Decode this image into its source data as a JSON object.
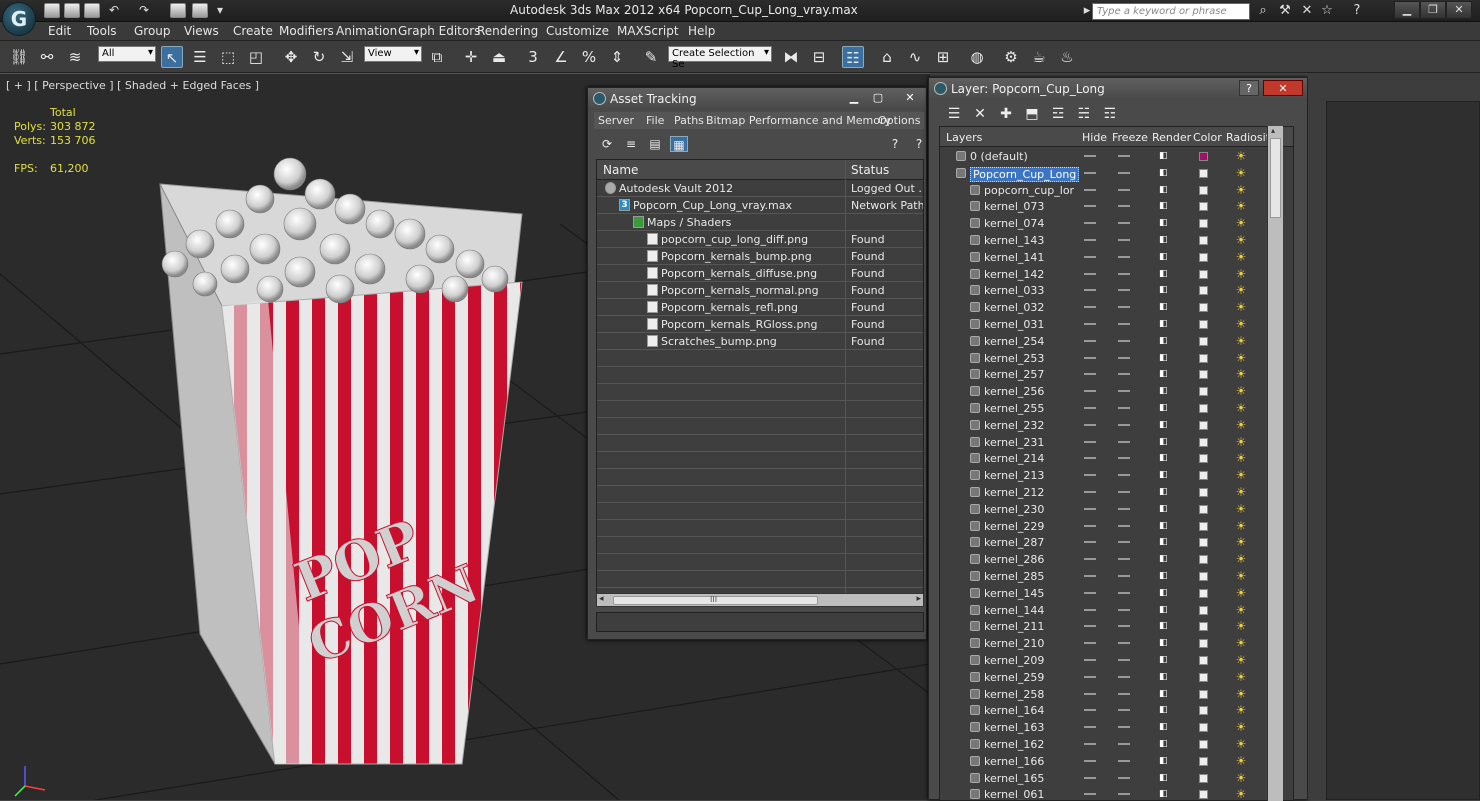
{
  "app": {
    "title": "Autodesk 3ds Max  2012 x64      Popcorn_Cup_Long_vray.max",
    "search_placeholder": "Type a keyword or phrase",
    "logo": "G"
  },
  "menu": [
    "Edit",
    "Tools",
    "Group",
    "Views",
    "Create",
    "Modifiers",
    "Animation",
    "Graph Editors",
    "Rendering",
    "Customize",
    "MAXScript",
    "Help"
  ],
  "toolbar": {
    "selection_filter": "All",
    "reference_coord": "View",
    "named_selection": "Create Selection Se"
  },
  "viewport": {
    "label": "[ + ] [ Perspective ] [ Shaded + Edged Faces ]",
    "stats_header": "Total",
    "polys_label": "Polys:",
    "polys_value": "303 872",
    "verts_label": "Verts:",
    "verts_value": "153 706",
    "fps_label": "FPS:",
    "fps_value": "61,200",
    "logo_text_1": "POP",
    "logo_text_2": "CORN"
  },
  "asset_tracking": {
    "title": "Asset Tracking",
    "menu": [
      "Server",
      "File",
      "Paths",
      "Bitmap Performance and Memory",
      "Options"
    ],
    "col_name": "Name",
    "col_status": "Status",
    "rows": [
      {
        "name": "Autodesk Vault 2012",
        "status": "Logged Out ...",
        "indent": 1,
        "icon": "vault"
      },
      {
        "name": "Popcorn_Cup_Long_vray.max",
        "status": "Network Path",
        "indent": 2,
        "icon": "max"
      },
      {
        "name": "Maps / Shaders",
        "status": "",
        "indent": 3,
        "icon": "maps"
      },
      {
        "name": "popcorn_cup_long_diff.png",
        "status": "Found",
        "indent": 4,
        "icon": "file"
      },
      {
        "name": "Popcorn_kernals_bump.png",
        "status": "Found",
        "indent": 4,
        "icon": "file"
      },
      {
        "name": "Popcorn_kernals_diffuse.png",
        "status": "Found",
        "indent": 4,
        "icon": "file"
      },
      {
        "name": "Popcorn_kernals_normal.png",
        "status": "Found",
        "indent": 4,
        "icon": "file"
      },
      {
        "name": "Popcorn_kernals_refl.png",
        "status": "Found",
        "indent": 4,
        "icon": "file"
      },
      {
        "name": "Popcorn_kernals_RGloss.png",
        "status": "Found",
        "indent": 4,
        "icon": "file"
      },
      {
        "name": "Scratches_bump.png",
        "status": "Found",
        "indent": 4,
        "icon": "file"
      }
    ],
    "scroll_grip": "III"
  },
  "layer_manager": {
    "title": "Layer: Popcorn_Cup_Long",
    "help_label": "?",
    "columns": {
      "layers": "Layers",
      "hide": "Hide",
      "freeze": "Freeze",
      "render": "Render",
      "color": "Color",
      "radiosity": "Radiosity"
    },
    "rows": [
      {
        "name": "0 (default)",
        "type": "layer",
        "color": "#a0106a"
      },
      {
        "name": "Popcorn_Cup_Long",
        "type": "layer-selected",
        "color": "#eeeeee"
      },
      {
        "name": "popcorn_cup_lor",
        "type": "object",
        "color": "#eeeeee"
      },
      {
        "name": "kernel_073",
        "type": "object",
        "color": "#eeeeee"
      },
      {
        "name": "kernel_074",
        "type": "object",
        "color": "#eeeeee"
      },
      {
        "name": "kernel_143",
        "type": "object",
        "color": "#eeeeee"
      },
      {
        "name": "kernel_141",
        "type": "object",
        "color": "#eeeeee"
      },
      {
        "name": "kernel_142",
        "type": "object",
        "color": "#eeeeee"
      },
      {
        "name": "kernel_033",
        "type": "object",
        "color": "#eeeeee"
      },
      {
        "name": "kernel_032",
        "type": "object",
        "color": "#eeeeee"
      },
      {
        "name": "kernel_031",
        "type": "object",
        "color": "#eeeeee"
      },
      {
        "name": "kernel_254",
        "type": "object",
        "color": "#eeeeee"
      },
      {
        "name": "kernel_253",
        "type": "object",
        "color": "#eeeeee"
      },
      {
        "name": "kernel_257",
        "type": "object",
        "color": "#eeeeee"
      },
      {
        "name": "kernel_256",
        "type": "object",
        "color": "#eeeeee"
      },
      {
        "name": "kernel_255",
        "type": "object",
        "color": "#eeeeee"
      },
      {
        "name": "kernel_232",
        "type": "object",
        "color": "#eeeeee"
      },
      {
        "name": "kernel_231",
        "type": "object",
        "color": "#eeeeee"
      },
      {
        "name": "kernel_214",
        "type": "object",
        "color": "#eeeeee"
      },
      {
        "name": "kernel_213",
        "type": "object",
        "color": "#eeeeee"
      },
      {
        "name": "kernel_212",
        "type": "object",
        "color": "#eeeeee"
      },
      {
        "name": "kernel_230",
        "type": "object",
        "color": "#eeeeee"
      },
      {
        "name": "kernel_229",
        "type": "object",
        "color": "#eeeeee"
      },
      {
        "name": "kernel_287",
        "type": "object",
        "color": "#eeeeee"
      },
      {
        "name": "kernel_286",
        "type": "object",
        "color": "#eeeeee"
      },
      {
        "name": "kernel_285",
        "type": "object",
        "color": "#eeeeee"
      },
      {
        "name": "kernel_145",
        "type": "object",
        "color": "#eeeeee"
      },
      {
        "name": "kernel_144",
        "type": "object",
        "color": "#eeeeee"
      },
      {
        "name": "kernel_211",
        "type": "object",
        "color": "#eeeeee"
      },
      {
        "name": "kernel_210",
        "type": "object",
        "color": "#eeeeee"
      },
      {
        "name": "kernel_209",
        "type": "object",
        "color": "#eeeeee"
      },
      {
        "name": "kernel_259",
        "type": "object",
        "color": "#eeeeee"
      },
      {
        "name": "kernel_258",
        "type": "object",
        "color": "#eeeeee"
      },
      {
        "name": "kernel_164",
        "type": "object",
        "color": "#eeeeee"
      },
      {
        "name": "kernel_163",
        "type": "object",
        "color": "#eeeeee"
      },
      {
        "name": "kernel_162",
        "type": "object",
        "color": "#eeeeee"
      },
      {
        "name": "kernel_166",
        "type": "object",
        "color": "#eeeeee"
      },
      {
        "name": "kernel_165",
        "type": "object",
        "color": "#eeeeee"
      },
      {
        "name": "kernel_061",
        "type": "object",
        "color": "#eeeeee"
      }
    ]
  },
  "colors": {
    "accent": "#3b6fa0",
    "cup_red": "#c8102e",
    "selection": "#3b74c4"
  }
}
